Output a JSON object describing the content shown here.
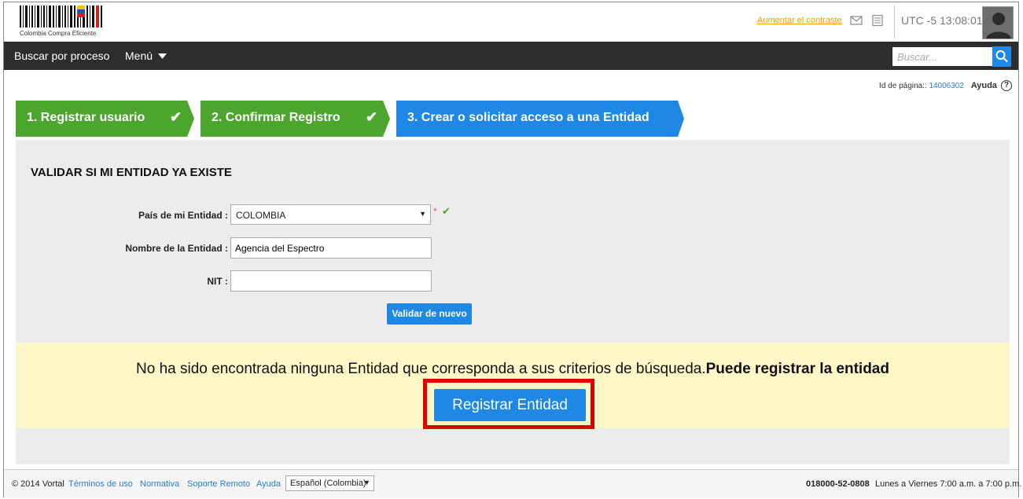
{
  "header": {
    "logo_text": "Colombia Compra Eficiente",
    "contrast_link": "Aumentar el contraste",
    "timezone": "UTC -5",
    "time": "13:08:01"
  },
  "nav": {
    "process_search": "Buscar por proceso",
    "menu": "Menú",
    "search_placeholder": "Buscar..."
  },
  "page_info": {
    "id_label": "Id de página::",
    "id_value": "14006302",
    "help": "Ayuda",
    "help_symbol": "?"
  },
  "steps": [
    {
      "label": "1. Registrar usuario",
      "status": "done",
      "color": "#4ca52d"
    },
    {
      "label": "2. Confirmar Registro",
      "status": "done",
      "color": "#4ca52d"
    },
    {
      "label": "3. Crear o solicitar acceso a una Entidad",
      "status": "current",
      "color": "#1f88e5"
    }
  ],
  "form": {
    "title": "VALIDAR SI MI ENTIDAD YA EXISTE",
    "country_label": "País de mi Entidad :",
    "country_value": "COLOMBIA",
    "required_mark": "*",
    "name_label": "Nombre de la Entidad :",
    "name_value": "Agencia del Espectro",
    "nit_label": "NIT :",
    "nit_value": "",
    "validate_button": "Validar de nuevo"
  },
  "notice": {
    "message": "No ha sido encontrada ninguna Entidad que corresponda a sus criterios de búsqueda.",
    "message_bold": "Puede registrar la entidad",
    "register_button": "Registrar Entidad",
    "highlight_color": "#e00000"
  },
  "footer": {
    "copyright": "© 2014 Vortal",
    "links": [
      "Términos de uso",
      "Normativa",
      "Soporte Remoto",
      "Ayuda"
    ],
    "language": "Español (Colombia)",
    "phone": "018000-52-0808",
    "hours": "Lunes a Viernes 7:00 a.m. a 7:00 p.m."
  },
  "colors": {
    "nav_bg": "#2d2d2d",
    "accent_blue": "#1f88e5",
    "step_green": "#4ca52d",
    "notice_bg": "#fdf7c8",
    "panel_bg": "#ececec"
  }
}
